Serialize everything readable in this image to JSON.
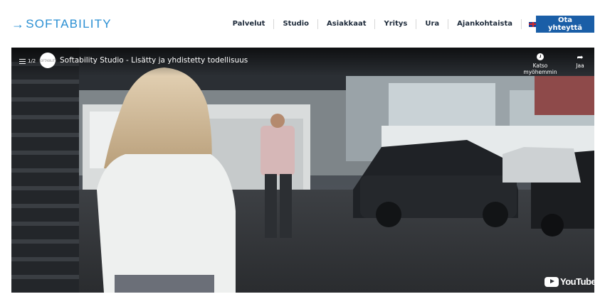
{
  "header": {
    "logo": "SOFTABILITY",
    "logo_arrow": "→",
    "nav": [
      "Palvelut",
      "Studio",
      "Asiakkaat",
      "Yritys",
      "Ura",
      "Ajankohtaista"
    ],
    "cta": "Ota yhteyttä",
    "flag_icon": "uk-flag-icon"
  },
  "video": {
    "playlist_count": "1/2",
    "title": "Softability Studio - Lisätty ja yhdistetty todellisuus",
    "watch_later": "Katso myöhemmin",
    "share": "Jaa",
    "brand": "YouTube",
    "channel_avatar_text": "SOFTABILITY"
  }
}
